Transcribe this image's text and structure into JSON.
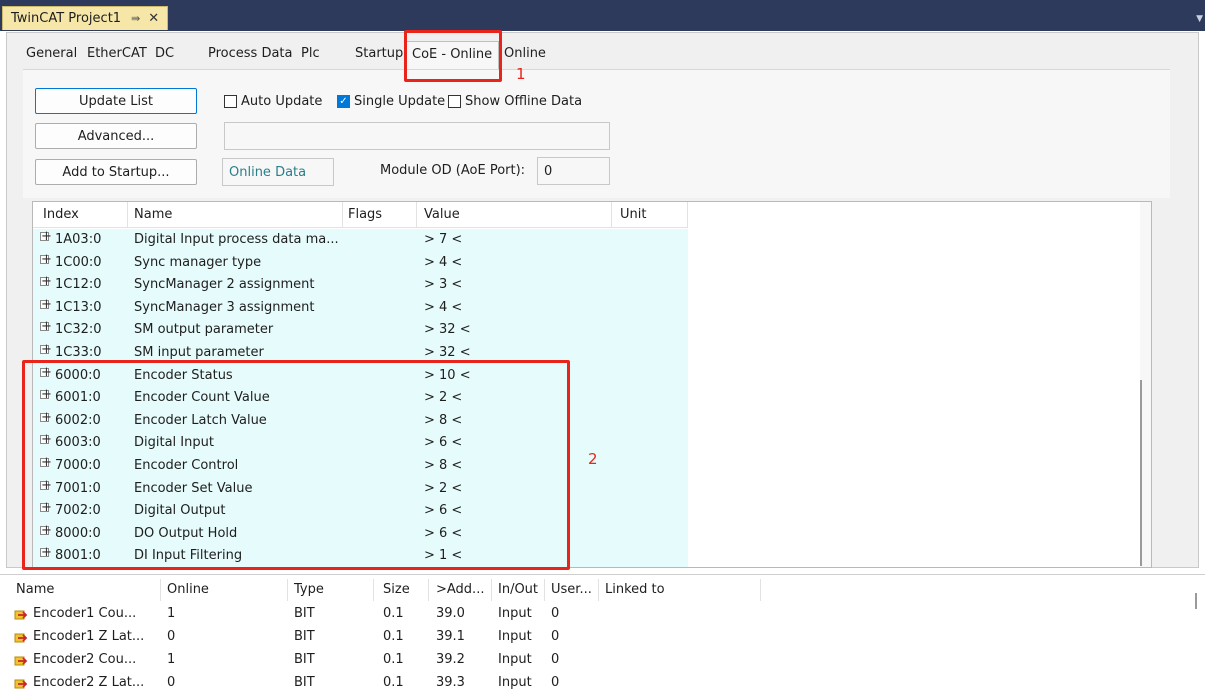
{
  "document_tab": {
    "title": "TwinCAT Project1",
    "pin_glyph": "⇛",
    "close_glyph": "✕"
  },
  "tabs": [
    "General",
    "EtherCAT",
    "DC",
    "Process Data",
    "Plc",
    "Startup",
    "CoE - Online",
    "Online"
  ],
  "active_tab": "CoE - Online",
  "annotations": {
    "one": "1",
    "two": "2"
  },
  "buttons": {
    "update_list": "Update List",
    "advanced": "Advanced...",
    "add_to_startup": "Add to Startup..."
  },
  "checkboxes": {
    "auto_update": {
      "label": "Auto Update",
      "checked": false
    },
    "single_update": {
      "label": "Single Update",
      "checked": true
    },
    "show_offline": {
      "label": "Show Offline Data",
      "checked": false
    }
  },
  "online_data_label": "Online Data",
  "module_od": {
    "label": "Module OD (AoE Port):",
    "value": "0"
  },
  "object_list": {
    "columns": [
      "Index",
      "Name",
      "Flags",
      "Value",
      "Unit"
    ],
    "rows": [
      {
        "index": "1A03:0",
        "name": "Digital Input process data ma...",
        "flags": "",
        "value": "> 7 <",
        "unit": ""
      },
      {
        "index": "1C00:0",
        "name": "Sync manager type",
        "flags": "",
        "value": "> 4 <",
        "unit": ""
      },
      {
        "index": "1C12:0",
        "name": "SyncManager 2 assignment",
        "flags": "",
        "value": "> 3 <",
        "unit": ""
      },
      {
        "index": "1C13:0",
        "name": "SyncManager 3 assignment",
        "flags": "",
        "value": "> 4 <",
        "unit": ""
      },
      {
        "index": "1C32:0",
        "name": "SM output parameter",
        "flags": "",
        "value": "> 32 <",
        "unit": ""
      },
      {
        "index": "1C33:0",
        "name": "SM input parameter",
        "flags": "",
        "value": "> 32 <",
        "unit": ""
      },
      {
        "index": "6000:0",
        "name": "Encoder Status",
        "flags": "",
        "value": "> 10 <",
        "unit": ""
      },
      {
        "index": "6001:0",
        "name": "Encoder Count Value",
        "flags": "",
        "value": "> 2 <",
        "unit": ""
      },
      {
        "index": "6002:0",
        "name": "Encoder Latch Value",
        "flags": "",
        "value": "> 8 <",
        "unit": ""
      },
      {
        "index": "6003:0",
        "name": "Digital Input",
        "flags": "",
        "value": "> 6 <",
        "unit": ""
      },
      {
        "index": "7000:0",
        "name": "Encoder Control",
        "flags": "",
        "value": "> 8 <",
        "unit": ""
      },
      {
        "index": "7001:0",
        "name": "Encoder Set Value",
        "flags": "",
        "value": "> 2 <",
        "unit": ""
      },
      {
        "index": "7002:0",
        "name": "Digital Output",
        "flags": "",
        "value": "> 6 <",
        "unit": ""
      },
      {
        "index": "8000:0",
        "name": "DO Output Hold",
        "flags": "",
        "value": "> 6 <",
        "unit": ""
      },
      {
        "index": "8001:0",
        "name": "DI Input Filtering",
        "flags": "",
        "value": "> 1 <",
        "unit": ""
      }
    ]
  },
  "variable_list": {
    "columns": [
      "Name",
      "Online",
      "Type",
      "Size",
      ">Add...",
      "In/Out",
      "User...",
      "Linked to"
    ],
    "rows": [
      {
        "name": "Encoder1 Cou...",
        "online": "1",
        "type": "BIT",
        "size": "0.1",
        "addr": "39.0",
        "inout": "Input",
        "user": "0",
        "linked": ""
      },
      {
        "name": "Encoder1 Z Lat...",
        "online": "0",
        "type": "BIT",
        "size": "0.1",
        "addr": "39.1",
        "inout": "Input",
        "user": "0",
        "linked": ""
      },
      {
        "name": "Encoder2 Cou...",
        "online": "1",
        "type": "BIT",
        "size": "0.1",
        "addr": "39.2",
        "inout": "Input",
        "user": "0",
        "linked": ""
      },
      {
        "name": "Encoder2 Z Lat...",
        "online": "0",
        "type": "BIT",
        "size": "0.1",
        "addr": "39.3",
        "inout": "Input",
        "user": "0",
        "linked": ""
      }
    ]
  },
  "colors": {
    "accent": "#0078d7",
    "annotation": "#e8241b",
    "row_highlight": "#e6fbfb",
    "tab_bar": "#2d3a5c"
  }
}
